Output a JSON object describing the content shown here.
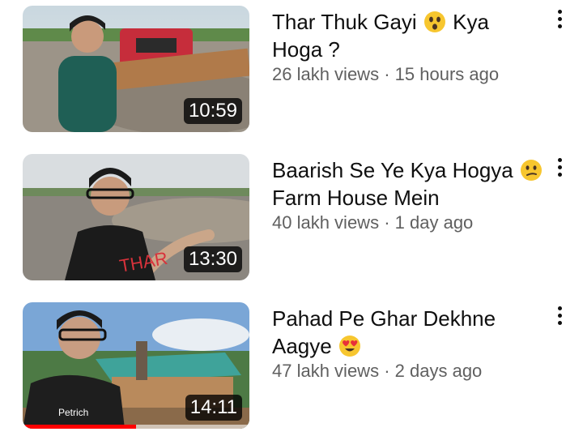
{
  "videos": [
    {
      "title": "Thar Thuk Gayi",
      "title_end": "Kya Hoga ?",
      "emoji": "astonished-face-emoji",
      "views": "26 lakh views",
      "age": "15 hours ago",
      "duration": "10:59",
      "progress": 0
    },
    {
      "title": "Baarish Se Ye Kya Hogya",
      "title_end": "Farm House Mein",
      "emoji": "confused-face-emoji",
      "views": "40 lakh views",
      "age": "1 day ago",
      "duration": "13:30",
      "progress": 0
    },
    {
      "title": "Pahad Pe Ghar Dekhne Aagye",
      "title_end": "",
      "emoji": "heart-eyes-emoji",
      "views": "47 lakh views",
      "age": "2 days ago",
      "duration": "14:11",
      "progress": 0.5
    }
  ],
  "meta_separator": "·",
  "colors": {
    "progress": "#ff0000",
    "meta_text": "#606060"
  },
  "icons": {
    "menu": "more-vertical-icon"
  }
}
